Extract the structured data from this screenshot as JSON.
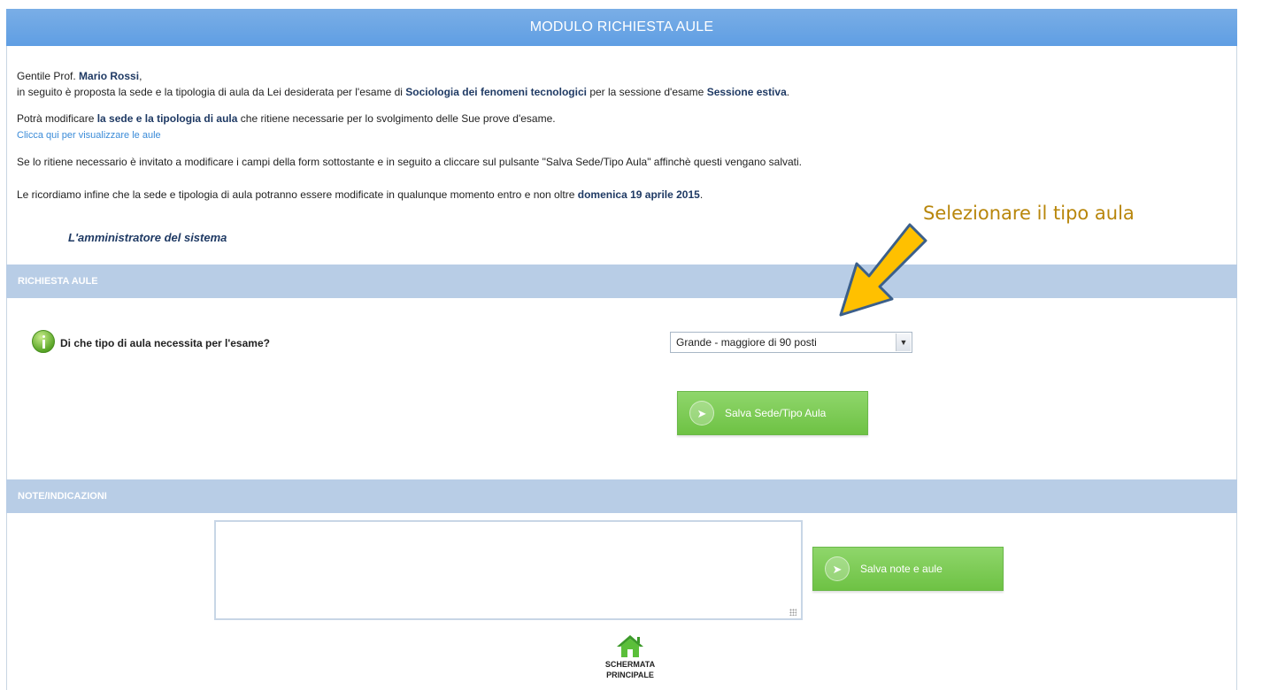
{
  "header": {
    "title": "MODULO RICHIESTA AULE"
  },
  "intro": {
    "greeting_prefix": "Gentile Prof.",
    "professor_name": "Mario Rossi",
    "greeting_suffix": ",",
    "line2_part1": "in seguito è proposta la sede e la tipologia di aula da Lei desiderata per l'esame di",
    "course_name": "Sociologia dei fenomeni tecnologici",
    "line2_part2": "per la sessione d'esame",
    "session_name": "Sessione estiva",
    "line2_end": ".",
    "line3_part1": "Potrà modificare",
    "line3_bold": "la sede e la tipologia di aula",
    "line3_part2": "che ritiene necessarie per lo svolgimento delle Sue prove d'esame.",
    "view_rooms_link": "Clicca qui per visualizzare le aule",
    "line4": "Se lo ritiene necessario è invitato a modificare i campi della form sottostante e in seguito a cliccare sul pulsante \"Salva Sede/Tipo Aula\" affinchè questi vengano salvati.",
    "line5_part1": "Le ricordiamo infine che la sede e tipologia di aula potranno essere modificate in qualunque momento entro e non oltre",
    "deadline": "domenica 19 aprile 2015",
    "line5_end": ".",
    "signature": "L'amministratore del sistema"
  },
  "sections": {
    "richiesta": "RICHIESTA AULE",
    "note": "NOTE/INDICAZIONI"
  },
  "form": {
    "question": "Di che tipo di aula necessita per l'esame?",
    "room_type_selected": "Grande - maggiore di 90 posti",
    "save_room_button": "Salva Sede/Tipo Aula",
    "notes_value": "",
    "save_notes_button": "Salva note e aule"
  },
  "home": {
    "label_line1": "SCHERMATA",
    "label_line2": "PRINCIPALE"
  },
  "annotation": {
    "text": "Selezionare il tipo aula"
  },
  "colors": {
    "title_bar": "#6aa6e6",
    "section_bar": "#b8cde6",
    "button_green": "#7ccc55",
    "emphasis_text": "#1f3a64",
    "link": "#3a8bd8",
    "annotation": "#b8860b",
    "arrow_fill": "#ffc000",
    "arrow_outline": "#3b5f8a"
  },
  "icons": {
    "info": "info-icon",
    "button_arrow": "arrow-right-circle-icon",
    "home": "home-icon",
    "select_caret": "chevron-down-icon"
  }
}
